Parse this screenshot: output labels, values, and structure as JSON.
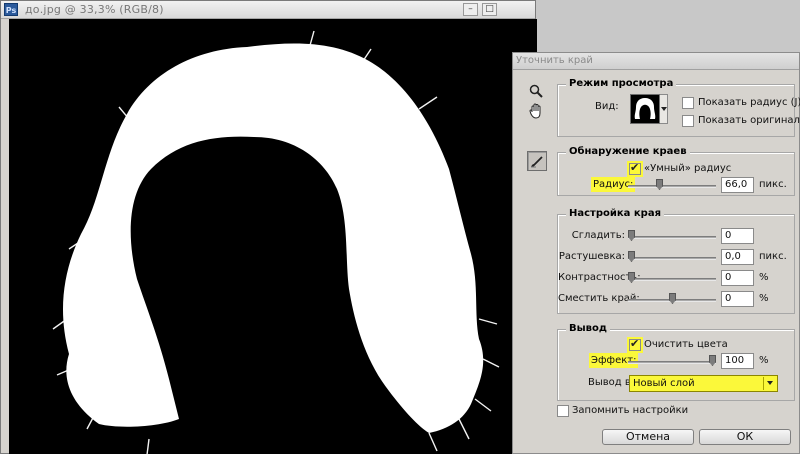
{
  "document": {
    "title": "до.jpg @ 33,3% (RGB/8)",
    "app_badge": "Ps",
    "min_glyph": "–",
    "max_glyph": "□"
  },
  "dialog": {
    "title": "Уточнить край",
    "tools": [
      {
        "icon": "zoom-icon"
      },
      {
        "icon": "hand-icon"
      },
      {
        "icon": "refine-radius-brush-icon"
      }
    ],
    "view_mode": {
      "title": "Режим просмотра",
      "view_label": "Вид:",
      "show_radius_label": "Показать радиус (J)",
      "show_radius_checked": false,
      "show_original_label": "Показать оригинал (P)",
      "show_original_checked": false
    },
    "edge_detection": {
      "title": "Обнаружение краев",
      "smart_radius_label": "«Умный» радиус",
      "smart_radius_checked": true,
      "radius_label": "Радиус:",
      "radius_value": "66,0",
      "radius_fraction": 0.35,
      "radius_unit": "пикс."
    },
    "adjust_edge": {
      "title": "Настройка края",
      "rows": [
        {
          "label": "Сгладить:",
          "value": "0",
          "unit": "",
          "fraction": 0.0
        },
        {
          "label": "Растушевка:",
          "value": "0,0",
          "unit": "пикс.",
          "fraction": 0.0
        },
        {
          "label": "Контрастность:",
          "value": "0",
          "unit": "%",
          "fraction": 0.0
        },
        {
          "label": "Сместить край:",
          "value": "0",
          "unit": "%",
          "fraction": 0.5
        }
      ]
    },
    "output": {
      "title": "Вывод",
      "decontaminate_label": "Очистить цвета",
      "decontaminate_checked": true,
      "amount_label": "Эффект:",
      "amount_value": "100",
      "amount_fraction": 1.0,
      "amount_unit": "%",
      "output_to_label": "Вывод в:",
      "output_to_value": "Новый слой"
    },
    "remember_label": "Запомнить настройки",
    "remember_checked": false,
    "cancel_label": "Отмена",
    "ok_label": "ОК"
  },
  "colors": {
    "highlight": "#fbf83a",
    "canvas_bg": "#000000",
    "hair_mask": "#ffffff"
  }
}
